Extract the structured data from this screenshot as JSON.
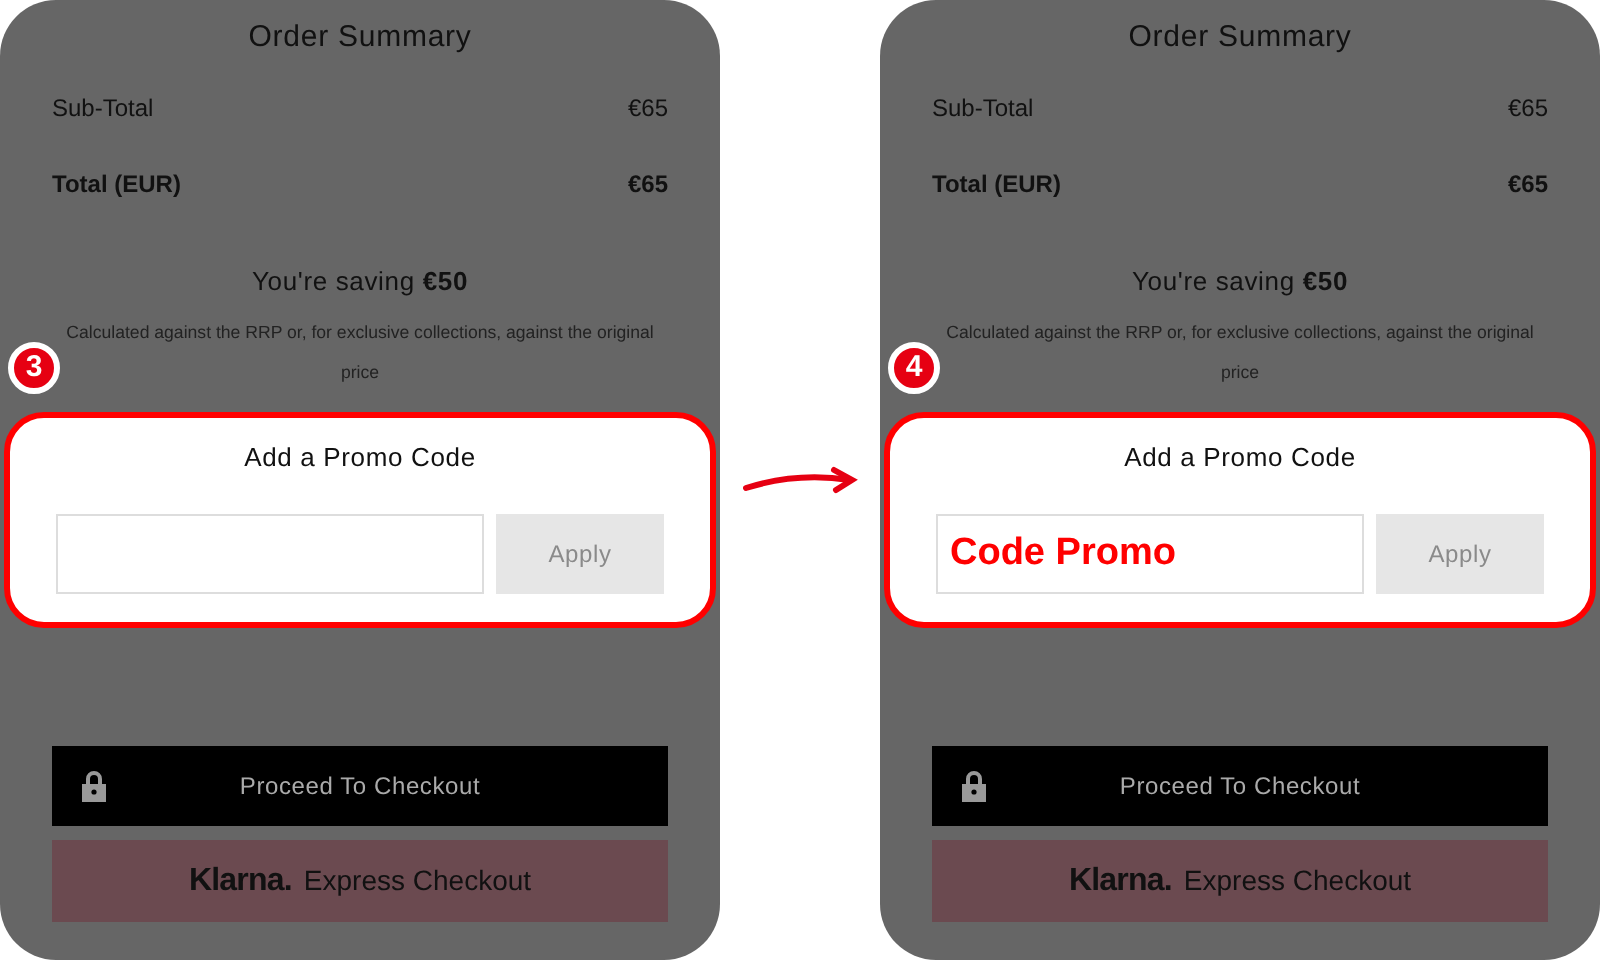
{
  "panels": [
    {
      "step": "3",
      "title": "Order Summary",
      "rows": [
        {
          "label": "Sub-Total",
          "value": "€65",
          "kind": "normal"
        },
        {
          "label": "Total (EUR)",
          "value": "€65",
          "kind": "total"
        }
      ],
      "saving": "You're saving **€50**",
      "note": "Calculated against the RRP or, for exclusive collections, against the original price",
      "promo": {
        "title": "Add a Promo Code",
        "apply": {
          "label": "Apply",
          "disabled": true
        }
      },
      "checkout": "Proceed To Checkout",
      "klarna": {
        "logo": "Klarna.",
        "label": "Express Checkout"
      }
    },
    {
      "step": "4",
      "title": "Order Summary",
      "rows": [
        {
          "label": "Sub-Total",
          "value": "€65",
          "kind": "normal"
        },
        {
          "label": "Total (EUR)",
          "value": "€65",
          "kind": "total"
        }
      ],
      "saving": "You're saving **€50**",
      "note": "Calculated against the RRP or, for exclusive collections, against the original price",
      "promo": {
        "title": "Add a Promo Code",
        "value": "Code Promo",
        "apply": {
          "label": "Apply",
          "disabled": true
        }
      },
      "checkout": "Proceed To Checkout",
      "klarna": {
        "logo": "Klarna.",
        "label": "Express Checkout"
      }
    }
  ]
}
